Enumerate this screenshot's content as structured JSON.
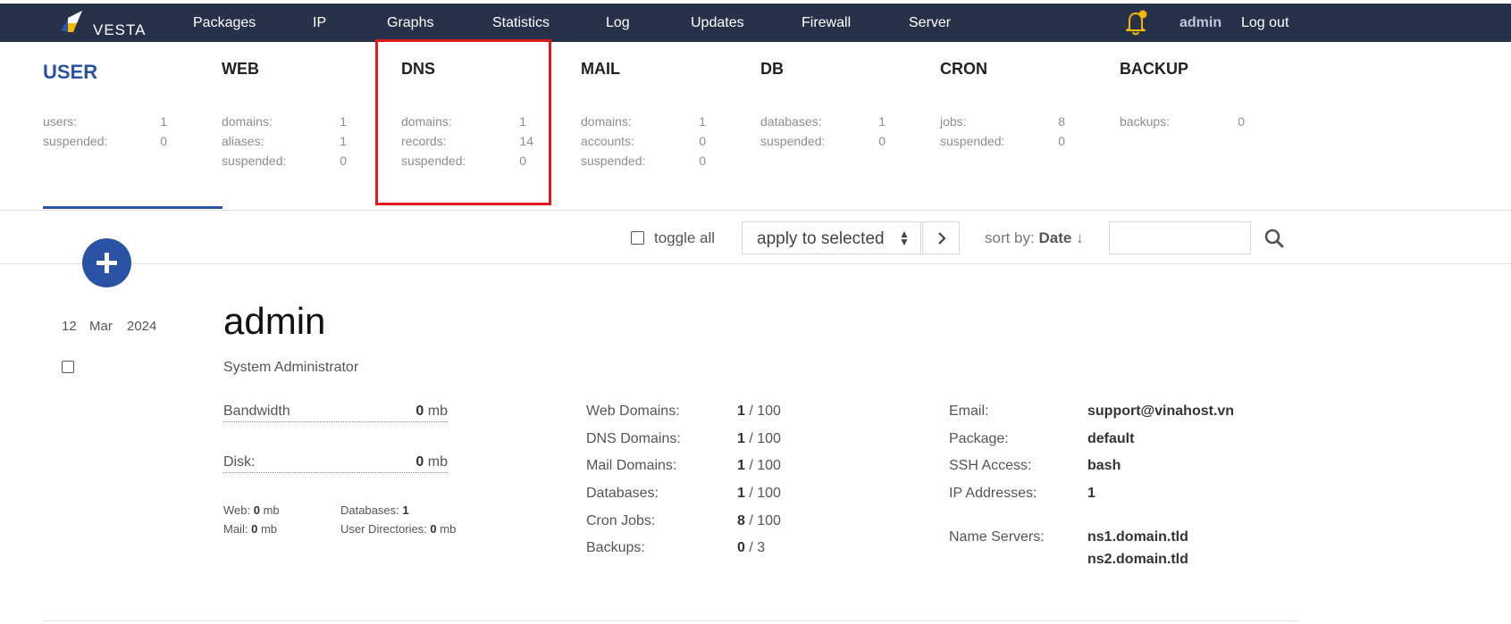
{
  "brand": {
    "name": "VESTA"
  },
  "nav": {
    "items": [
      "Packages",
      "IP",
      "Graphs",
      "Statistics",
      "Log",
      "Updates",
      "Firewall",
      "Server"
    ],
    "user": "admin",
    "logout": "Log out"
  },
  "stats": {
    "user": {
      "title": "USER",
      "rows": [
        [
          "users:",
          "1"
        ],
        [
          "suspended:",
          "0"
        ]
      ]
    },
    "web": {
      "title": "WEB",
      "rows": [
        [
          "domains:",
          "1"
        ],
        [
          "aliases:",
          "1"
        ],
        [
          "suspended:",
          "0"
        ]
      ]
    },
    "dns": {
      "title": "DNS",
      "rows": [
        [
          "domains:",
          "1"
        ],
        [
          "records:",
          "14"
        ],
        [
          "suspended:",
          "0"
        ]
      ]
    },
    "mail": {
      "title": "MAIL",
      "rows": [
        [
          "domains:",
          "1"
        ],
        [
          "accounts:",
          "0"
        ],
        [
          "suspended:",
          "0"
        ]
      ]
    },
    "db": {
      "title": "DB",
      "rows": [
        [
          "databases:",
          "1"
        ],
        [
          "suspended:",
          "0"
        ]
      ]
    },
    "cron": {
      "title": "CRON",
      "rows": [
        [
          "jobs:",
          "8"
        ],
        [
          "suspended:",
          "0"
        ]
      ]
    },
    "backup": {
      "title": "BACKUP",
      "rows": [
        [
          "backups:",
          "0"
        ]
      ]
    }
  },
  "toolbar": {
    "toggle_all": "toggle all",
    "apply_select": "apply to selected",
    "sort_prefix": "sort by:",
    "sort_field": "Date",
    "sort_arrow": "↓",
    "search_value": ""
  },
  "user_row": {
    "date": {
      "day": "12",
      "month": "Mar",
      "year": "2024"
    },
    "name": "admin",
    "role": "System Administrator",
    "bandwidth": {
      "label": "Bandwidth",
      "value": "0",
      "unit": "mb"
    },
    "disk": {
      "label": "Disk:",
      "value": "0",
      "unit": "mb"
    },
    "disk_breakdown": {
      "web_label": "Web:",
      "web_value": "0",
      "web_unit": "mb",
      "mail_label": "Mail:",
      "mail_value": "0",
      "mail_unit": "mb",
      "db_label": "Databases:",
      "db_value": "1",
      "udir_label": "User Directories:",
      "udir_value": "0",
      "udir_unit": "mb"
    },
    "limits": [
      {
        "label": "Web Domains:",
        "used": "1",
        "max": "100"
      },
      {
        "label": "DNS Domains:",
        "used": "1",
        "max": "100"
      },
      {
        "label": "Mail Domains:",
        "used": "1",
        "max": "100"
      },
      {
        "label": "Databases:",
        "used": "1",
        "max": "100"
      },
      {
        "label": "Cron Jobs:",
        "used": "8",
        "max": "100"
      },
      {
        "label": "Backups:",
        "used": "0",
        "max": "3"
      }
    ],
    "info": {
      "email_label": "Email:",
      "email": "support@vinahost.vn",
      "package_label": "Package:",
      "package": "default",
      "ssh_label": "SSH Access:",
      "ssh": "bash",
      "ip_label": "IP Addresses:",
      "ip": "1",
      "ns_label": "Name Servers:",
      "ns1": "ns1.domain.tld",
      "ns2": "ns2.domain.tld"
    }
  },
  "colors": {
    "nav_bg": "#27324a",
    "accent": "#2a53a6",
    "highlight": "#e01a1a",
    "bell": "#f5b800"
  }
}
